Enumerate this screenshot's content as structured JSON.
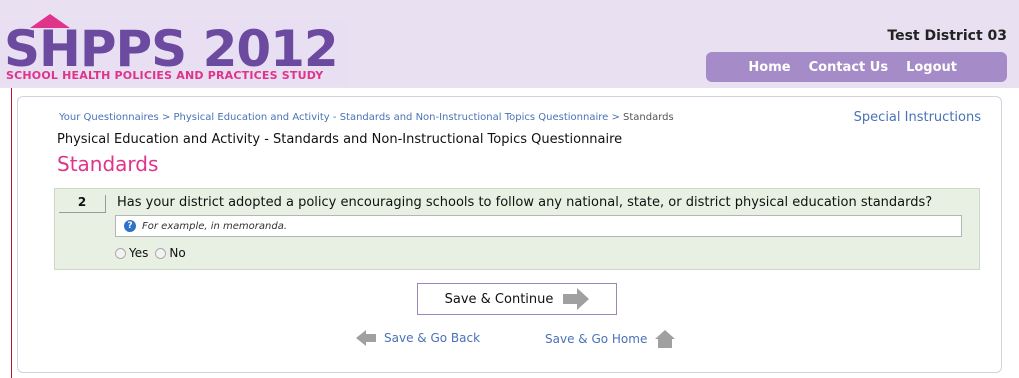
{
  "header": {
    "logo_main": "SHPPS 2012",
    "logo_subtitle": "SCHOOL HEALTH POLICIES AND PRACTICES STUDY",
    "district": "Test District 03",
    "nav": [
      "Home",
      "Contact Us",
      "Logout"
    ]
  },
  "breadcrumb": {
    "items": [
      "Your Questionnaires",
      "Physical Education and Activity - Standards and Non-Instructional Topics Questionnaire"
    ],
    "separator": " > ",
    "current": "Standards"
  },
  "special_instructions": "Special Instructions",
  "questionnaire_title": "Physical Education and Activity - Standards and Non-Instructional Topics Questionnaire",
  "section_title": "Standards",
  "question": {
    "number": "2",
    "text": "Has your district adopted a policy encouraging schools to follow any national, state, or district physical education standards?",
    "hint": "For example, in memoranda.",
    "options": [
      "Yes",
      "No"
    ]
  },
  "buttons": {
    "save_continue": "Save & Continue",
    "save_back": "Save & Go Back",
    "save_home": "Save & Go Home"
  },
  "colors": {
    "accent_purple": "#a58cc8",
    "accent_pink": "#e0338a",
    "link_blue": "#4a72b8"
  },
  "icons": [
    "info-icon",
    "arrow-right-icon",
    "arrow-left-icon",
    "house-icon"
  ]
}
